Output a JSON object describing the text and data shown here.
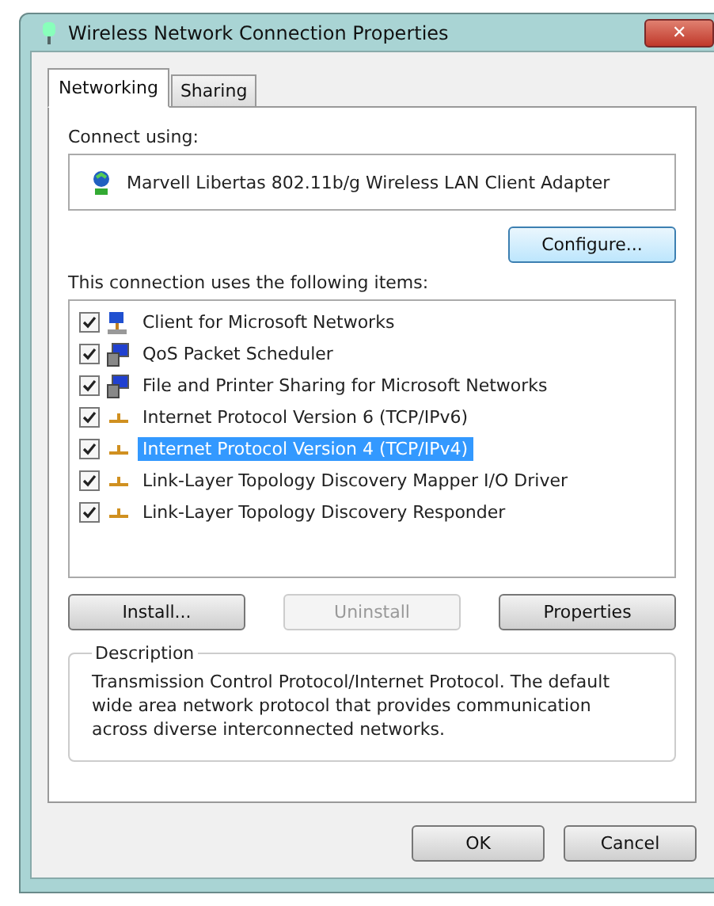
{
  "window": {
    "title": "Wireless Network Connection Properties",
    "close": "✕"
  },
  "tabs": [
    {
      "label": "Networking",
      "selected": true
    },
    {
      "label": "Sharing",
      "selected": false
    }
  ],
  "connect_using": {
    "label": "Connect using:",
    "adapter": "Marvell Libertas 802.11b/g Wireless LAN Client Adapter",
    "configure": "Configure..."
  },
  "items_label": "This connection uses the following items:",
  "items": [
    {
      "kind": "client",
      "label": "Client for Microsoft Networks",
      "checked": true,
      "selected": false
    },
    {
      "kind": "service",
      "label": "QoS Packet Scheduler",
      "checked": true,
      "selected": false
    },
    {
      "kind": "service",
      "label": "File and Printer Sharing for Microsoft Networks",
      "checked": true,
      "selected": false
    },
    {
      "kind": "protocol",
      "label": "Internet Protocol Version 6 (TCP/IPv6)",
      "checked": true,
      "selected": false
    },
    {
      "kind": "protocol",
      "label": "Internet Protocol Version 4 (TCP/IPv4)",
      "checked": true,
      "selected": true
    },
    {
      "kind": "protocol",
      "label": "Link-Layer Topology Discovery Mapper I/O Driver",
      "checked": true,
      "selected": false
    },
    {
      "kind": "protocol",
      "label": "Link-Layer Topology Discovery Responder",
      "checked": true,
      "selected": false
    }
  ],
  "item_buttons": [
    {
      "label": "Install...",
      "disabled": false
    },
    {
      "label": "Uninstall",
      "disabled": true
    },
    {
      "label": "Properties",
      "disabled": false
    }
  ],
  "description": {
    "title": "Description",
    "text": "Transmission Control Protocol/Internet Protocol. The default wide area network protocol that provides communication across diverse interconnected networks."
  },
  "buttons": [
    "OK",
    "Cancel"
  ]
}
